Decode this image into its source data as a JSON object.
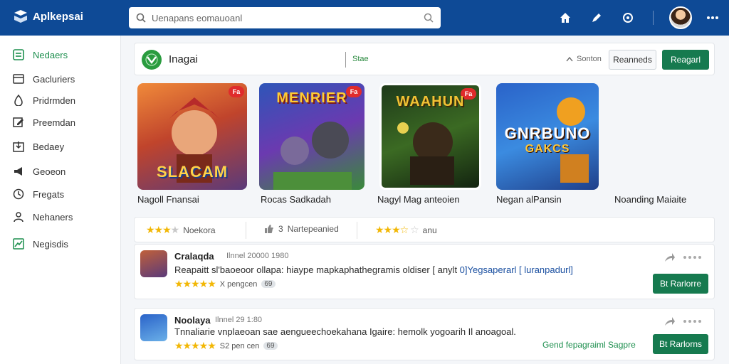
{
  "topbar": {
    "brand": "Aplkepsai",
    "search_placeholder": "Uenapans eomauoanl",
    "icons": [
      "home-icon",
      "pen-icon",
      "refresh-icon",
      "more-icon"
    ]
  },
  "sidebar": {
    "items": [
      {
        "label": "Nedaers",
        "icon": "list-icon",
        "active": true
      },
      {
        "label": "Gacluriers",
        "icon": "board-icon",
        "active": false
      },
      {
        "label": "Pridrmden",
        "icon": "drop-icon",
        "active": false
      },
      {
        "label": "Preemdan",
        "icon": "edit-icon",
        "active": false
      },
      {
        "label": "Bedaey",
        "icon": "download-icon",
        "active": false
      },
      {
        "label": "Geoeon",
        "icon": "megaphone-icon",
        "active": false
      },
      {
        "label": "Fregats",
        "icon": "clock-icon",
        "active": false
      },
      {
        "label": "Nehaners",
        "icon": "people-icon",
        "active": false
      },
      {
        "label": "Negisdis",
        "icon": "chart-icon",
        "active": false
      }
    ]
  },
  "app_header": {
    "name": "Inagai",
    "tag": "Stae",
    "sort_label": "Sonton",
    "outline_button": "Reanneds",
    "primary_button": "Reagarl"
  },
  "tiles": [
    {
      "title": "SLACAM",
      "caption": "Nagoll Fnansai",
      "badge": "Fa"
    },
    {
      "title": "MENRIER",
      "caption": "Rocas Sadkadah",
      "badge": "Fa"
    },
    {
      "title": "WAAHUN",
      "caption": "Nagyl Mag anteoien",
      "badge": "Fa"
    },
    {
      "title": "GNRBUNO",
      "subtitle": "GAKCS",
      "caption": "Negan alPansin",
      "badge": ""
    },
    {
      "caption": "Noanding Maiaite"
    }
  ],
  "rating_bar": {
    "groups": [
      {
        "stars": 3,
        "label": "Noekora"
      },
      {
        "icon": "thumb-icon",
        "count": "3",
        "label": "Nartepeanied"
      },
      {
        "stars": 3.5,
        "label": "anu"
      }
    ]
  },
  "reviews": [
    {
      "name": "Cralaqda",
      "meta": "Ilnnel 20000 1980",
      "text_main": "Reapaitt sl'baoeoor ollapa: hiaype mapkaphathegramis oldiser [ anylt ",
      "text_highlight": "0]Yegsaperarl [ luranpadurl]",
      "stars": 5,
      "rating_text": "X pengcen",
      "count_badge": "69",
      "button": "Bt Rarlorre"
    },
    {
      "name": "Noolaya",
      "meta": "Ilnnel 29 1:80",
      "text_main": "Tnnaliarie vnplaeoan sae aengueechoekahana Igaire: hemolk yogoarih Il anoagoal.",
      "text_highlight": "",
      "stars": 5,
      "rating_text": "S2 pen cen",
      "count_badge": "69",
      "link": "Gend fepagraiml Sagpre",
      "button": "Bt Rarlorns"
    }
  ],
  "colors": {
    "topbar": "#0e4a96",
    "accent_green": "#167a4f",
    "star": "#f2b705"
  }
}
